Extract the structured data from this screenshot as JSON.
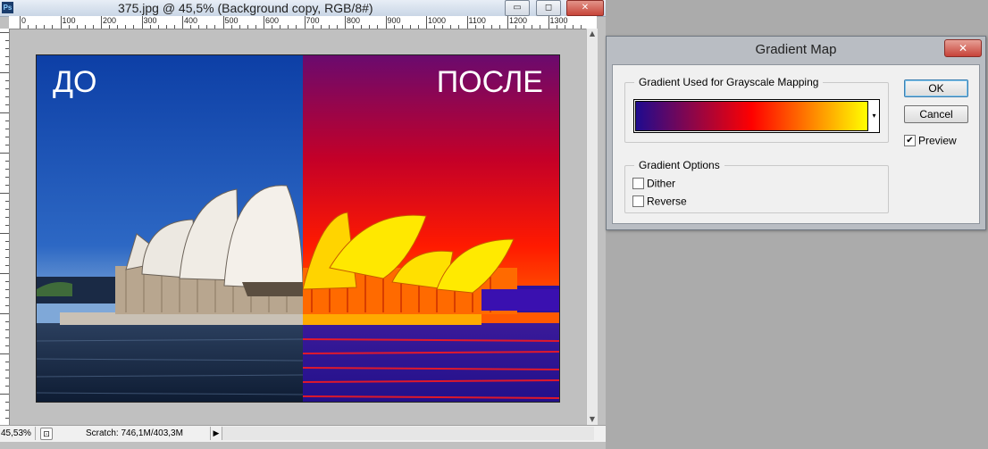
{
  "document_window": {
    "title": "375.jpg @ 45,5% (Background copy, RGB/8#)",
    "app_icon_text": "Ps",
    "minimize_symbol": "▭",
    "maximize_symbol": "◻",
    "close_symbol": "✕",
    "ruler_labels": [
      "0",
      "100",
      "200",
      "300",
      "400",
      "500",
      "600",
      "700",
      "800",
      "900",
      "1000",
      "1100",
      "1200",
      "1300"
    ],
    "status_bar": {
      "zoom": "45,53%",
      "scratch": "Scratch: 746,1M/403,3M",
      "menu_arrow": "▶"
    },
    "image_overlay": {
      "before_label": "ДО",
      "after_label": "ПОСЛЕ"
    }
  },
  "dialog": {
    "title": "Gradient Map",
    "close_symbol": "✕",
    "mapping_group_label": "Gradient Used for Grayscale Mapping",
    "gradient_stops": [
      "#1f0b8f",
      "#ff0000",
      "#ffff00"
    ],
    "dropdown_symbol": "▾",
    "options_group_label": "Gradient Options",
    "dither_label": "Dither",
    "dither_checked": false,
    "reverse_label": "Reverse",
    "reverse_checked": false,
    "ok_label": "OK",
    "cancel_label": "Cancel",
    "preview_label": "Preview",
    "preview_checked": true,
    "check_symbol": "✔"
  }
}
